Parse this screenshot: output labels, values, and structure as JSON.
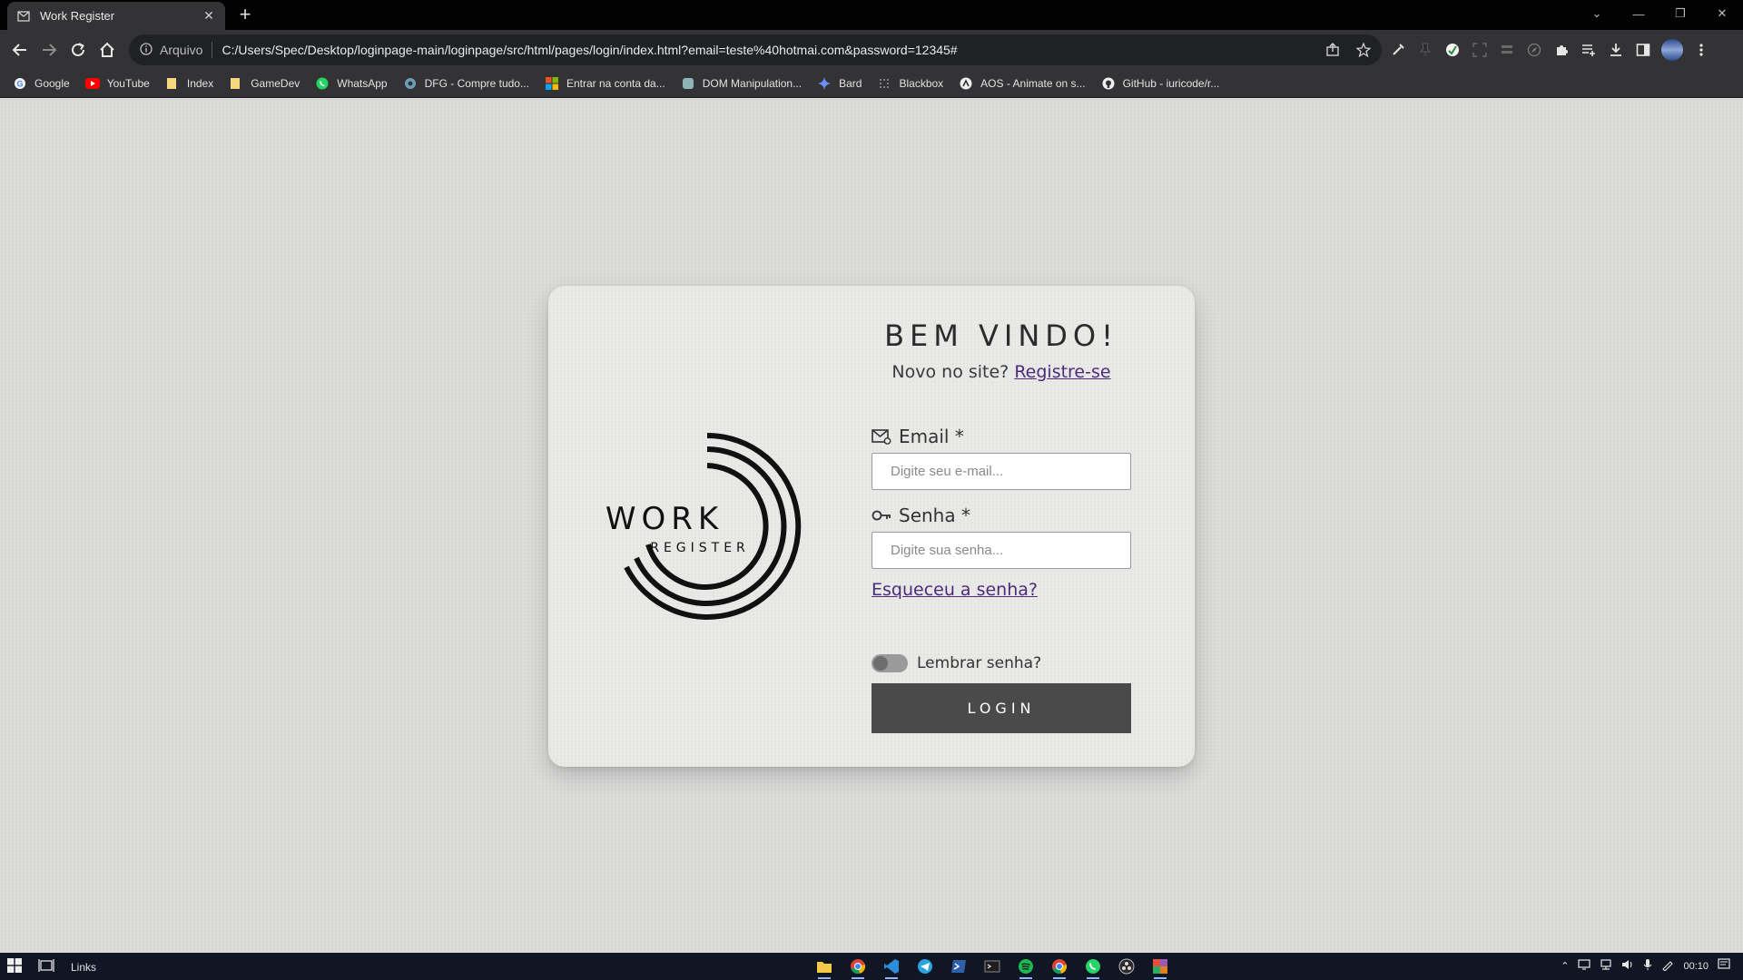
{
  "browser": {
    "tab": {
      "title": "Work Register",
      "favicon": "envelope-icon"
    },
    "new_tab_label": "+",
    "address": {
      "security_label": "Arquivo",
      "url": "C:/Users/Spec/Desktop/loginpage-main/loginpage/src/html/pages/login/index.html?email=teste%40hotmai.com&password=12345#"
    },
    "bookmarks": [
      {
        "label": "Google",
        "icon": "google-icon"
      },
      {
        "label": "YouTube",
        "icon": "youtube-icon"
      },
      {
        "label": "Index",
        "icon": "folder-icon"
      },
      {
        "label": "GameDev",
        "icon": "folder-icon"
      },
      {
        "label": "WhatsApp",
        "icon": "whatsapp-icon"
      },
      {
        "label": "DFG - Compre tudo...",
        "icon": "dfg-icon"
      },
      {
        "label": "Entrar na conta da...",
        "icon": "microsoft-icon"
      },
      {
        "label": "DOM Manipulation...",
        "icon": "site-icon"
      },
      {
        "label": "Bard",
        "icon": "bard-icon"
      },
      {
        "label": "Blackbox",
        "icon": "blackbox-icon"
      },
      {
        "label": "AOS - Animate on s...",
        "icon": "aos-icon"
      },
      {
        "label": "GitHub - iuricode/r...",
        "icon": "github-icon"
      }
    ]
  },
  "login": {
    "logo": {
      "line1": "WORK",
      "line2": "REGISTER"
    },
    "title": "BEM VINDO!",
    "subtitle": "Novo no site?",
    "register_link": "Registre-se",
    "email_label": "Email *",
    "email_placeholder": "Digite seu e-mail...",
    "password_label": "Senha *",
    "password_placeholder": "Digite sua senha...",
    "forgot_link": "Esqueceu a senha?",
    "remember_label": "Lembrar senha?",
    "remember_on": false,
    "login_button": "LOGIN"
  },
  "taskbar": {
    "links_label": "Links",
    "time": "00:10"
  },
  "colors": {
    "page_bg": "#dcdcdb",
    "card_bg": "#e9e9e8",
    "link": "#4a2c7a",
    "button_bg": "#4a4a4a"
  }
}
